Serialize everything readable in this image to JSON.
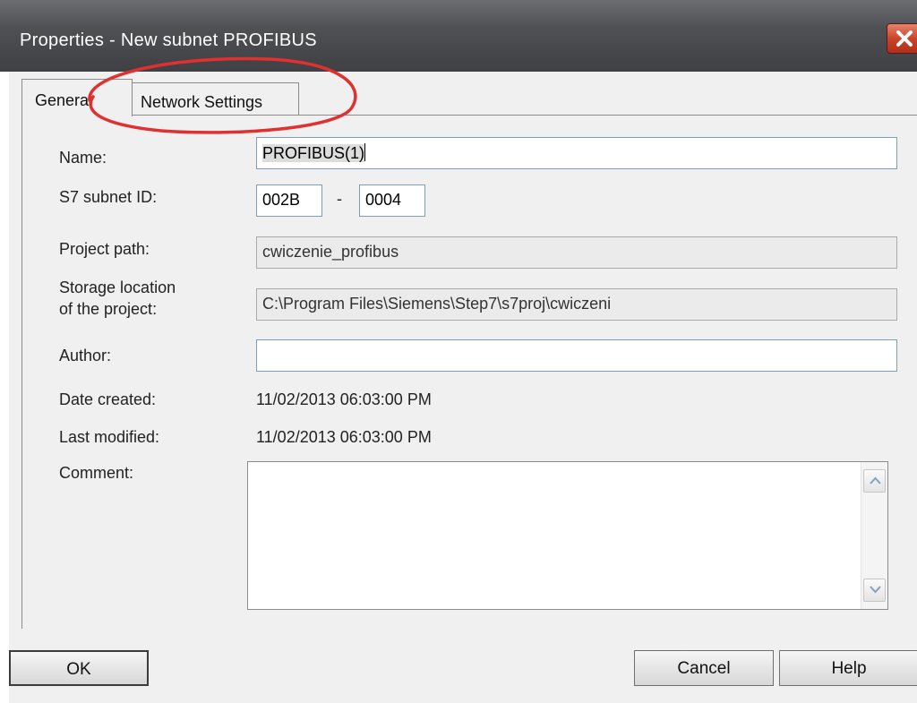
{
  "window": {
    "title": "Properties -  New subnet PROFIBUS"
  },
  "tabs": [
    {
      "label": "General"
    },
    {
      "label": "Network Settings"
    }
  ],
  "general": {
    "name_label": "Name:",
    "name_value": "PROFIBUS(1)",
    "subnet_id_label": "S7 subnet ID:",
    "subnet_id_part1": "002B",
    "subnet_id_separator": "-",
    "subnet_id_part2": "0004",
    "project_path_label": "Project path:",
    "project_path_value": "cwiczenie_profibus",
    "storage_label_line1": "Storage location",
    "storage_label_line2": "of the project:",
    "storage_value": "C:\\Program Files\\Siemens\\Step7\\s7proj\\cwiczeni",
    "author_label": "Author:",
    "author_value": "",
    "date_created_label": "Date created:",
    "date_created_value": "11/02/2013 06:03:00 PM",
    "last_modified_label": "Last modified:",
    "last_modified_value": "11/02/2013 06:03:00 PM",
    "comment_label": "Comment:",
    "comment_value": ""
  },
  "buttons": {
    "ok": "OK",
    "cancel": "Cancel",
    "help": "Help"
  },
  "annotation": {
    "color": "#e03030"
  }
}
